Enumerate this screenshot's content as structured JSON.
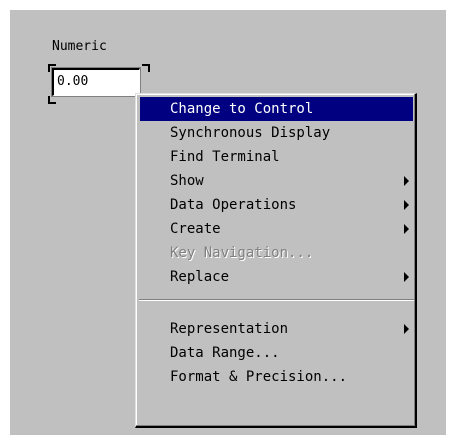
{
  "control": {
    "label": "Numeric",
    "value": "0.00"
  },
  "context_menu": {
    "items": [
      {
        "label": "Change to Control",
        "highlighted": true,
        "submenu": false,
        "enabled": true
      },
      {
        "label": "Synchronous Display",
        "highlighted": false,
        "submenu": false,
        "enabled": true
      },
      {
        "label": "Find Terminal",
        "highlighted": false,
        "submenu": false,
        "enabled": true
      },
      {
        "label": "Show",
        "highlighted": false,
        "submenu": true,
        "enabled": true
      },
      {
        "label": "Data Operations",
        "highlighted": false,
        "submenu": true,
        "enabled": true
      },
      {
        "label": "Create",
        "highlighted": false,
        "submenu": true,
        "enabled": true
      },
      {
        "label": "Key Navigation...",
        "highlighted": false,
        "submenu": false,
        "enabled": false
      },
      {
        "label": "Replace",
        "highlighted": false,
        "submenu": true,
        "enabled": true
      },
      {
        "label": "Representation",
        "highlighted": false,
        "submenu": true,
        "enabled": true
      },
      {
        "label": "Data Range...",
        "highlighted": false,
        "submenu": false,
        "enabled": true
      },
      {
        "label": "Format & Precision...",
        "highlighted": false,
        "submenu": false,
        "enabled": true
      }
    ]
  },
  "colors": {
    "panel_background": "#c0c0c0",
    "highlight": "#000080",
    "highlight_text": "#ffffff",
    "disabled_text": "#808080"
  }
}
